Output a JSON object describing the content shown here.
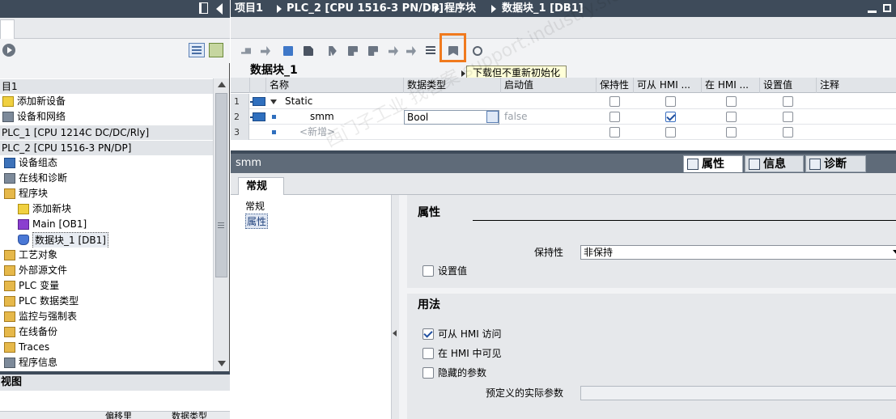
{
  "left": {
    "tree": [
      {
        "label": "目1",
        "band": true,
        "icon": "",
        "indent": 0
      },
      {
        "label": "添加新设备",
        "band": false,
        "icon": "add-device-icon",
        "indent": 0
      },
      {
        "label": "设备和网络",
        "band": false,
        "icon": "network-icon",
        "indent": 0
      },
      {
        "label": "PLC_1 [CPU 1214C DC/DC/Rly]",
        "band": true,
        "icon": "",
        "indent": 0
      },
      {
        "label": "PLC_2 [CPU 1516-3 PN/DP]",
        "band": true,
        "icon": "",
        "indent": 0
      },
      {
        "label": "设备组态",
        "band": false,
        "icon": "device-config-icon",
        "indent": 1
      },
      {
        "label": "在线和诊断",
        "band": false,
        "icon": "online-diagnostics-icon",
        "indent": 1
      },
      {
        "label": "程序块",
        "band": false,
        "icon": "program-blocks-folder-icon",
        "indent": 1
      },
      {
        "label": "添加新块",
        "band": false,
        "icon": "add-block-icon",
        "indent": 2
      },
      {
        "label": "Main [OB1]",
        "band": false,
        "icon": "ob-block-icon",
        "indent": 2
      },
      {
        "label": "数据块_1 [DB1]",
        "band": false,
        "icon": "db-block-icon",
        "indent": 2,
        "selected": true
      },
      {
        "label": "工艺对象",
        "band": false,
        "icon": "tech-objects-folder-icon",
        "indent": 1
      },
      {
        "label": "外部源文件",
        "band": false,
        "icon": "external-source-folder-icon",
        "indent": 1
      },
      {
        "label": "PLC 变量",
        "band": false,
        "icon": "plc-tags-folder-icon",
        "indent": 1
      },
      {
        "label": "PLC 数据类型",
        "band": false,
        "icon": "plc-datatypes-folder-icon",
        "indent": 1
      },
      {
        "label": "监控与强制表",
        "band": false,
        "icon": "watch-tables-folder-icon",
        "indent": 1
      },
      {
        "label": "在线备份",
        "band": false,
        "icon": "online-backup-folder-icon",
        "indent": 1
      },
      {
        "label": "Traces",
        "band": false,
        "icon": "traces-folder-icon",
        "indent": 1
      },
      {
        "label": "程序信息",
        "band": false,
        "icon": "program-info-icon",
        "indent": 1
      }
    ],
    "overview": {
      "title": "视图",
      "col_offset": "偏移里",
      "col_type": "数据类型"
    }
  },
  "breadcrumb": {
    "items": [
      "项目1",
      "PLC_2 [CPU 1516-3 PN/DP]",
      "程序块",
      "数据块_1 [DB1]"
    ]
  },
  "toolbar": {
    "tooltip": "下载但不重新初始化"
  },
  "editor": {
    "title": "数据块_1",
    "columns": [
      "名称",
      "数据类型",
      "启动值",
      "保持性",
      "可从 HMI ...",
      "在 HMI ...",
      "设置值",
      "注释"
    ],
    "rows": [
      {
        "num": "1",
        "name": "Static",
        "type": "",
        "start": "",
        "expand": true,
        "retain": false,
        "hmi_access": false,
        "hmi_visible": false,
        "setpoint": false
      },
      {
        "num": "2",
        "name": "smm",
        "type": "Bool",
        "start": "false",
        "expand": false,
        "retain": false,
        "hmi_access": true,
        "hmi_visible": false,
        "setpoint": false
      },
      {
        "num": "3",
        "name": "<新增>",
        "type": "",
        "start": "",
        "expand": false,
        "retain": false,
        "hmi_access": false,
        "hmi_visible": false,
        "setpoint": false
      }
    ]
  },
  "inspector": {
    "title": "smm",
    "tabs": [
      "属性",
      "信息",
      "诊断"
    ],
    "subtab": "常规",
    "nav": [
      "常规",
      "属性"
    ],
    "sec_props": {
      "title": "属性",
      "retain_label": "保持性",
      "retain_value": "非保持",
      "setpoint_label": "设置值"
    },
    "sec_usage": {
      "title": "用法",
      "hmi_access_label": "可从 HMI 访问",
      "hmi_visible_label": "在 HMI 中可见",
      "hidden_label": "隐藏的参数",
      "actual_param_label": "预定义的实际参数"
    }
  },
  "watermark": "西门子工业  找答案  support.industry.siemens.com/cs",
  "colors": {
    "highlight": "#f07a1e",
    "title_bar": "#3e4b5a"
  }
}
